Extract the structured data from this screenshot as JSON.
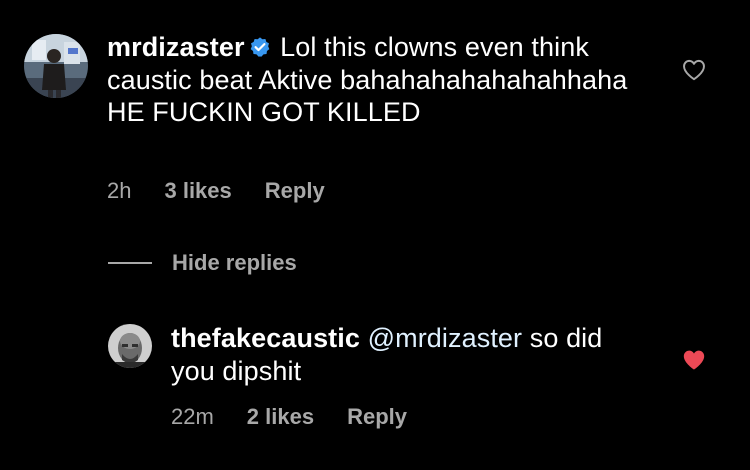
{
  "comments": [
    {
      "username": "mrdizaster",
      "verified": true,
      "text": "Lol this clowns even think caustic beat Aktive bahahahahahahahhaha HE FUCKIN GOT KILLED",
      "time": "2h",
      "likes": "3 likes",
      "reply_label": "Reply",
      "liked": false,
      "avatar_icon": "user-photo-avatar"
    }
  ],
  "replies_toggle": {
    "label": "Hide replies"
  },
  "replies": [
    {
      "username": "thefakecaustic",
      "mention": "@mrdizaster",
      "text": "so did you dipshit",
      "time": "22m",
      "likes": "2 likes",
      "reply_label": "Reply",
      "liked": true,
      "avatar_icon": "user-photo-avatar"
    }
  ],
  "colors": {
    "background": "#000000",
    "text": "#ffffff",
    "muted": "#a8a8a8",
    "verified": "#3897f0",
    "heart_liked": "#ed4956",
    "mention": "#e0f1ff"
  }
}
